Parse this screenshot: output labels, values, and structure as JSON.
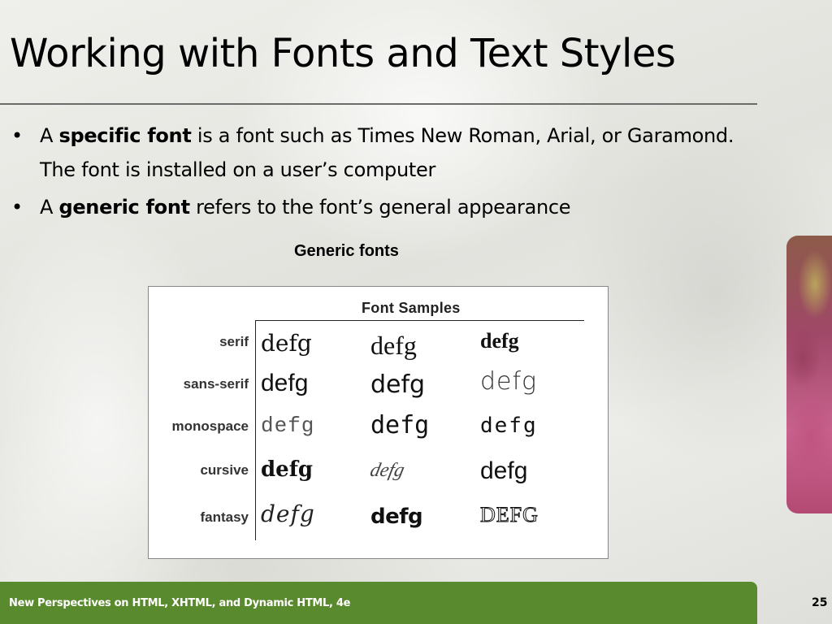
{
  "slide": {
    "title": "Working with Fonts and Text Styles",
    "bullets": [
      {
        "marker": "•",
        "before": "A ",
        "bold": "specific font",
        "after": " is a font such as Times New Roman, Arial, or Garamond.  The font is installed on a user’s computer"
      },
      {
        "marker": "•",
        "before": "A ",
        "bold": "generic font",
        "after": " refers to the font’s general appearance"
      }
    ],
    "caption": "Generic fonts"
  },
  "figure": {
    "title": "Font Samples",
    "rows": [
      {
        "label": "serif",
        "samples": [
          "defg",
          "defg",
          "defg"
        ]
      },
      {
        "label": "sans-serif",
        "samples": [
          "defg",
          "defg",
          "defg"
        ]
      },
      {
        "label": "monospace",
        "samples": [
          "defg",
          "defg",
          "defg"
        ]
      },
      {
        "label": "cursive",
        "samples": [
          "defg",
          "defg",
          "defg"
        ]
      },
      {
        "label": "fantasy",
        "samples": [
          "defg",
          "defg",
          "DEFG"
        ]
      }
    ]
  },
  "footer": {
    "text": "New Perspectives on HTML, XHTML, and Dynamic HTML, 4e",
    "page_number": "25",
    "color": "#5a8a2e"
  }
}
